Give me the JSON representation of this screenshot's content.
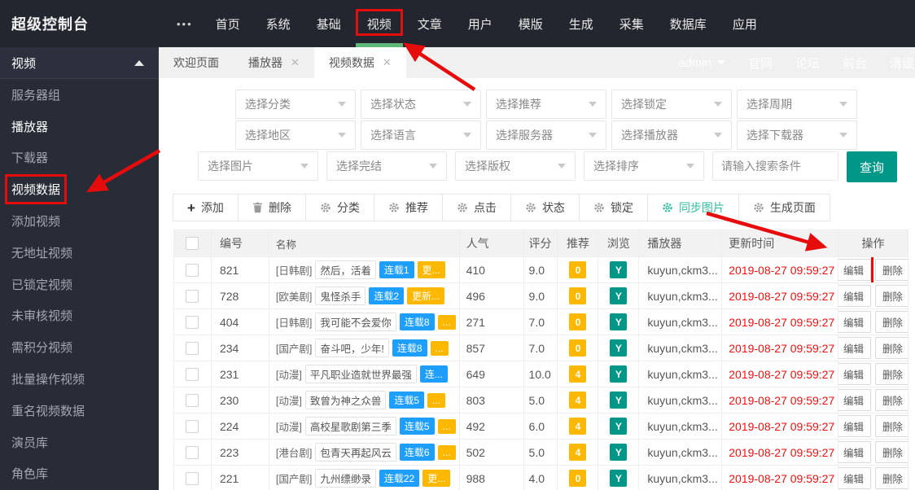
{
  "topbar": {
    "brand": "超级控制台",
    "more": "•••",
    "items": [
      "首页",
      "系统",
      "基础",
      "视频",
      "文章",
      "用户",
      "模版",
      "生成",
      "采集",
      "数据库",
      "应用"
    ],
    "active": "视频"
  },
  "userbar": {
    "username": "admin",
    "links": [
      "官网",
      "论坛",
      "前台",
      "清缓存"
    ]
  },
  "sidebar": {
    "group_label": "视频",
    "items": [
      {
        "label": "服务器组",
        "bright": false,
        "annotated": false
      },
      {
        "label": "播放器",
        "bright": true,
        "annotated": false
      },
      {
        "label": "下载器",
        "bright": false,
        "annotated": false
      },
      {
        "label": "视频数据",
        "bright": true,
        "annotated": true
      },
      {
        "label": "添加视频",
        "bright": false,
        "annotated": false
      },
      {
        "label": "无地址视频",
        "bright": false,
        "annotated": false
      },
      {
        "label": "已锁定视频",
        "bright": false,
        "annotated": false
      },
      {
        "label": "未审核视频",
        "bright": false,
        "annotated": false
      },
      {
        "label": "需积分视频",
        "bright": false,
        "annotated": false
      },
      {
        "label": "批量操作视频",
        "bright": false,
        "annotated": false
      },
      {
        "label": "重名视频数据",
        "bright": false,
        "annotated": false
      },
      {
        "label": "演员库",
        "bright": false,
        "annotated": false
      },
      {
        "label": "角色库",
        "bright": false,
        "annotated": false
      }
    ]
  },
  "tabs": [
    {
      "label": "欢迎页面",
      "closable": false,
      "active": false
    },
    {
      "label": "播放器",
      "closable": true,
      "active": false
    },
    {
      "label": "视频数据",
      "closable": true,
      "active": true
    }
  ],
  "filters": {
    "row1": [
      "选择分类",
      "选择状态",
      "选择推荐",
      "选择锁定",
      "选择周期"
    ],
    "row2": [
      "选择地区",
      "选择语言",
      "选择服务器",
      "选择播放器",
      "选择下载器"
    ],
    "row3": [
      "选择图片",
      "选择完结",
      "选择版权",
      "选择排序"
    ],
    "search_placeholder": "请输入搜索条件",
    "query_button": "查询"
  },
  "toolbar": {
    "buttons": [
      {
        "icon": "plus",
        "label": "添加",
        "accent": false
      },
      {
        "icon": "trash",
        "label": "删除",
        "accent": false
      },
      {
        "icon": "gear",
        "label": "分类",
        "accent": false
      },
      {
        "icon": "gear",
        "label": "推荐",
        "accent": false
      },
      {
        "icon": "gear",
        "label": "点击",
        "accent": false
      },
      {
        "icon": "gear",
        "label": "状态",
        "accent": false
      },
      {
        "icon": "gear",
        "label": "锁定",
        "accent": false
      },
      {
        "icon": "gear",
        "label": "同步图片",
        "accent": true
      },
      {
        "icon": "gear",
        "label": "生成页面",
        "accent": false
      }
    ]
  },
  "table": {
    "columns": [
      {
        "key": "id",
        "label": "编号"
      },
      {
        "key": "name",
        "label": "名称"
      },
      {
        "key": "pop",
        "label": "人气"
      },
      {
        "key": "score",
        "label": "评分"
      },
      {
        "key": "rec",
        "label": "推荐"
      },
      {
        "key": "view",
        "label": "浏览"
      },
      {
        "key": "player",
        "label": "播放器"
      },
      {
        "key": "time",
        "label": "更新时间"
      },
      {
        "key": "op",
        "label": "操作"
      }
    ],
    "edit_label": "编辑",
    "delete_label": "删除",
    "rows": [
      {
        "id": "821",
        "category": "[日韩剧]",
        "name": "然后，活着",
        "serial": "连载1",
        "update": "更...",
        "popularity": "410",
        "score": "9.0",
        "recommend": "0",
        "visible": "Y",
        "player": "kuyun,ckm3...",
        "updated": "2019-08-27 09:59:27",
        "edit_annotated": true
      },
      {
        "id": "728",
        "category": "[欧美剧]",
        "name": "鬼怪杀手",
        "serial": "连载2",
        "update": "更新...",
        "popularity": "496",
        "score": "9.0",
        "recommend": "0",
        "visible": "Y",
        "player": "kuyun,ckm3...",
        "updated": "2019-08-27 09:59:27",
        "edit_annotated": false
      },
      {
        "id": "404",
        "category": "[日韩剧]",
        "name": "我可能不会爱你",
        "serial": "连载8",
        "update": "...",
        "popularity": "271",
        "score": "7.0",
        "recommend": "0",
        "visible": "Y",
        "player": "kuyun,ckm3...",
        "updated": "2019-08-27 09:59:27",
        "edit_annotated": false
      },
      {
        "id": "234",
        "category": "[国产剧]",
        "name": "奋斗吧，少年!",
        "serial": "连载8",
        "update": "...",
        "popularity": "857",
        "score": "7.0",
        "recommend": "0",
        "visible": "Y",
        "player": "kuyun,ckm3...",
        "updated": "2019-08-27 09:59:27",
        "edit_annotated": false
      },
      {
        "id": "231",
        "category": "[动漫]",
        "name": "平凡职业造就世界最强",
        "serial": "连...",
        "update": null,
        "popularity": "649",
        "score": "10.0",
        "recommend": "4",
        "visible": "Y",
        "player": "kuyun,ckm3...",
        "updated": "2019-08-27 09:59:27",
        "edit_annotated": false
      },
      {
        "id": "230",
        "category": "[动漫]",
        "name": "致曾为神之众兽",
        "serial": "连载5",
        "update": "...",
        "popularity": "803",
        "score": "5.0",
        "recommend": "4",
        "visible": "Y",
        "player": "kuyun,ckm3...",
        "updated": "2019-08-27 09:59:27",
        "edit_annotated": false
      },
      {
        "id": "224",
        "category": "[动漫]",
        "name": "高校星歌剧第三季",
        "serial": "连载5",
        "update": "...",
        "popularity": "492",
        "score": "6.0",
        "recommend": "4",
        "visible": "Y",
        "player": "kuyun,ckm3...",
        "updated": "2019-08-27 09:59:27",
        "edit_annotated": false
      },
      {
        "id": "223",
        "category": "[港台剧]",
        "name": "包青天再起风云",
        "serial": "连载6",
        "update": "...",
        "popularity": "502",
        "score": "5.0",
        "recommend": "4",
        "visible": "Y",
        "player": "kuyun,ckm3...",
        "updated": "2019-08-27 09:59:27",
        "edit_annotated": false
      },
      {
        "id": "221",
        "category": "[国产剧]",
        "name": "九州缥缈录",
        "serial": "连载22",
        "update": "更...",
        "popularity": "988",
        "score": "4.0",
        "recommend": "0",
        "visible": "Y",
        "player": "kuyun,ckm3...",
        "updated": "2019-08-27 09:59:27",
        "edit_annotated": false
      }
    ]
  },
  "colors": {
    "accent_green": "#5FB878",
    "teal": "#009688",
    "badge_blue": "#1E9FFF",
    "badge_orange": "#FFB800",
    "annotation_red": "#e60c0c",
    "date_red": "#f40f0f"
  }
}
